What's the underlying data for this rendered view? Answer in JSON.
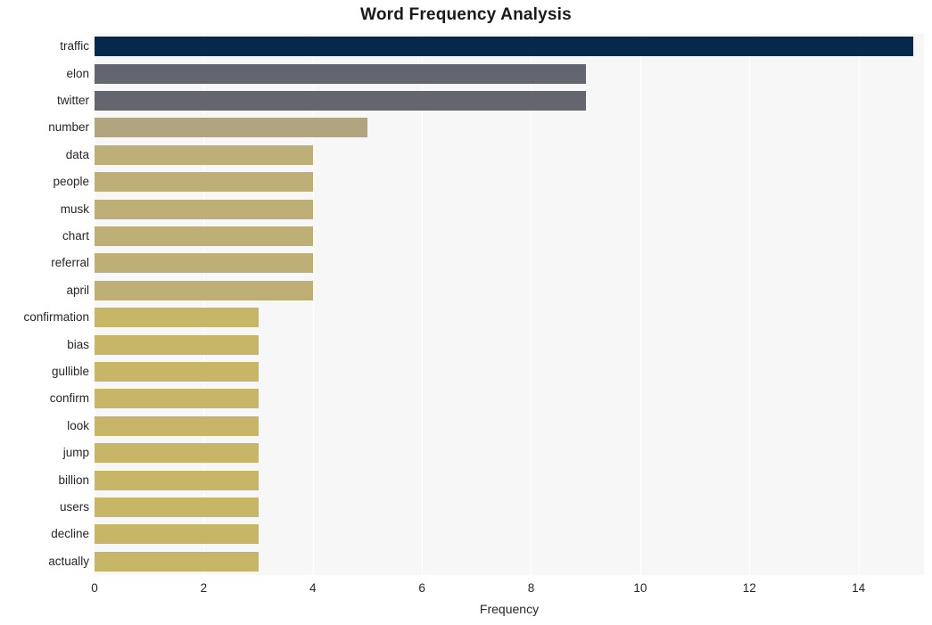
{
  "chart_data": {
    "type": "bar",
    "orientation": "horizontal",
    "title": "Word Frequency Analysis",
    "xlabel": "Frequency",
    "ylabel": "",
    "xlim": [
      0,
      15.2
    ],
    "grid": true,
    "legend": "none",
    "xticks": [
      0,
      2,
      4,
      6,
      8,
      10,
      12,
      14
    ],
    "categories": [
      "traffic",
      "elon",
      "twitter",
      "number",
      "data",
      "people",
      "musk",
      "chart",
      "referral",
      "april",
      "confirmation",
      "bias",
      "gullible",
      "confirm",
      "look",
      "jump",
      "billion",
      "users",
      "decline",
      "actually"
    ],
    "values": [
      15,
      9,
      9,
      5,
      4,
      4,
      4,
      4,
      4,
      4,
      3,
      3,
      3,
      3,
      3,
      3,
      3,
      3,
      3,
      3
    ],
    "bar_colors": [
      "#06284b",
      "#63666e",
      "#63666e",
      "#b0a57e",
      "#bdaf76",
      "#bdaf76",
      "#bdaf76",
      "#bdaf76",
      "#bdaf76",
      "#bdaf76",
      "#c7b568",
      "#c7b568",
      "#c7b568",
      "#c7b568",
      "#c7b568",
      "#c7b568",
      "#c7b568",
      "#c7b568",
      "#c7b568",
      "#c7b568"
    ],
    "plot_background": "#f7f7f7",
    "gridline_color": "#ffffff",
    "figure_background": "#ffffff"
  }
}
